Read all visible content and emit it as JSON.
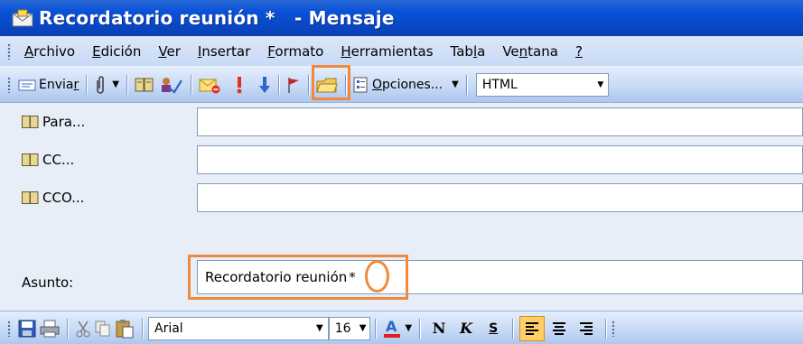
{
  "window": {
    "title": "Recordatorio reunión *   - Mensaje"
  },
  "menu": [
    {
      "pre": "",
      "u": "A",
      "post": "rchivo"
    },
    {
      "pre": "",
      "u": "E",
      "post": "dición"
    },
    {
      "pre": "",
      "u": "V",
      "post": "er"
    },
    {
      "pre": "",
      "u": "I",
      "post": "nsertar"
    },
    {
      "pre": "",
      "u": "F",
      "post": "ormato"
    },
    {
      "pre": "",
      "u": "H",
      "post": "erramientas"
    },
    {
      "pre": "Tab",
      "u": "l",
      "post": "a"
    },
    {
      "pre": "Ve",
      "u": "n",
      "post": "tana"
    },
    {
      "pre": "",
      "u": "?",
      "post": ""
    }
  ],
  "toolbar": {
    "send_label_pre": "Envia",
    "send_label_u": "r",
    "options_label_pre": "O",
    "options_label_post": "pciones...",
    "format_value": "HTML"
  },
  "header": {
    "to_label": "Para...",
    "cc_label": "CC...",
    "bcc_label": "CCO...",
    "subject_label": "Asunto:",
    "to_value": "",
    "cc_value": "",
    "bcc_value": "",
    "subject_value": "Recordatorio reunión",
    "subject_marker": "*"
  },
  "format": {
    "font": "Arial",
    "size": "16",
    "bold_label": "N",
    "italic_label": "K",
    "strike_label": "S"
  },
  "colors": {
    "highlight": "#f08a3a",
    "titlebar": "#0b52d8",
    "font_color_bar": "#e02020"
  },
  "icons": [
    "envelope-icon",
    "send-icon",
    "paperclip-icon",
    "address-book-icon",
    "check-names-icon",
    "flag-icon",
    "importance-high-icon",
    "importance-low-icon",
    "folder-icon",
    "options-icon",
    "save-icon",
    "print-icon",
    "cut-icon",
    "copy-icon",
    "paste-icon",
    "font-color-icon",
    "align-left-icon",
    "align-center-icon",
    "align-right-icon"
  ]
}
